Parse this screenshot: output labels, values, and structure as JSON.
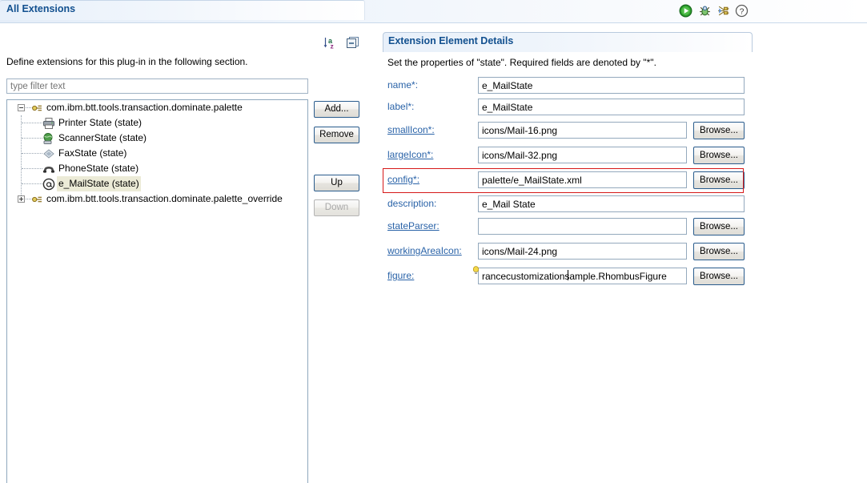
{
  "titlebar": {
    "title": "Extensions",
    "icon": "extensions-icon",
    "tools": [
      {
        "name": "run-icon",
        "label": "Run"
      },
      {
        "name": "debug-icon",
        "label": "Debug"
      },
      {
        "name": "extensions-icon",
        "label": "Extensions"
      },
      {
        "name": "help-icon",
        "label": "Help"
      }
    ]
  },
  "left": {
    "section_title": "All Extensions",
    "description": "Define extensions for this plug-in in the following section.",
    "filter_placeholder": "type filter text",
    "filter_value": "",
    "sort_icon": "sort-az-icon",
    "collapse_icon": "collapse-all-icon",
    "tree": [
      {
        "label": "com.ibm.btt.tools.transaction.dominate.palette",
        "icon": "extension-point-icon",
        "depth": 0,
        "expanded": true,
        "selected": false
      },
      {
        "label": "Printer State (state)",
        "icon": "printer-icon",
        "depth": 1,
        "expanded": null,
        "selected": false
      },
      {
        "label": "ScannerState (state)",
        "icon": "scanner-icon",
        "depth": 1,
        "expanded": null,
        "selected": false
      },
      {
        "label": "FaxState (state)",
        "icon": "fax-icon",
        "depth": 1,
        "expanded": null,
        "selected": false
      },
      {
        "label": "PhoneState (state)",
        "icon": "phone-icon",
        "depth": 1,
        "expanded": null,
        "selected": false
      },
      {
        "label": "e_MailState (state)",
        "icon": "email-at-icon",
        "depth": 1,
        "expanded": null,
        "selected": true
      },
      {
        "label": "com.ibm.btt.tools.transaction.dominate.palette_override",
        "icon": "extension-point-icon",
        "depth": 0,
        "expanded": false,
        "selected": false
      }
    ],
    "buttons": {
      "add": "Add...",
      "remove": "Remove",
      "up": "Up",
      "down": "Down",
      "down_disabled": true
    }
  },
  "right": {
    "section_title": "Extension Element Details",
    "description": "Set the properties of \"state\". Required fields are denoted by \"*\".",
    "browse_label": "Browse...",
    "fields": [
      {
        "label": "name*:",
        "value": "e_MailState",
        "link": false,
        "browse": false,
        "width": "wide",
        "name": "name"
      },
      {
        "label": "label*:",
        "value": "e_MailState",
        "link": false,
        "browse": false,
        "width": "wide",
        "name": "label"
      },
      {
        "label": "smallIcon*:",
        "value": "icons/Mail-16.png",
        "link": true,
        "browse": true,
        "width": "narrow",
        "name": "smallicon"
      },
      {
        "label": "largeIcon*:",
        "value": "icons/Mail-32.png",
        "link": true,
        "browse": true,
        "width": "narrow",
        "name": "largeicon"
      },
      {
        "label": "config*:",
        "value": "palette/e_MailState.xml",
        "link": true,
        "browse": true,
        "width": "narrow",
        "name": "config"
      },
      {
        "label": "description:",
        "value": "e_Mail State",
        "link": false,
        "browse": false,
        "width": "wide",
        "name": "description"
      },
      {
        "label": "stateParser:",
        "value": "",
        "link": true,
        "browse": true,
        "width": "narrow",
        "name": "stateparser"
      },
      {
        "label": "workingAreaIcon:",
        "value": "icons/Mail-24.png",
        "link": true,
        "browse": true,
        "width": "narrow",
        "name": "workingareaicon"
      },
      {
        "label": "figure:",
        "value": "rancecustomizationsample.RhombusFigure",
        "link": true,
        "browse": true,
        "width": "narrow",
        "name": "figure"
      }
    ],
    "highlight": {
      "field": "config",
      "color": "#d61818"
    },
    "figure_hint_icon": "lightbulb-icon"
  }
}
